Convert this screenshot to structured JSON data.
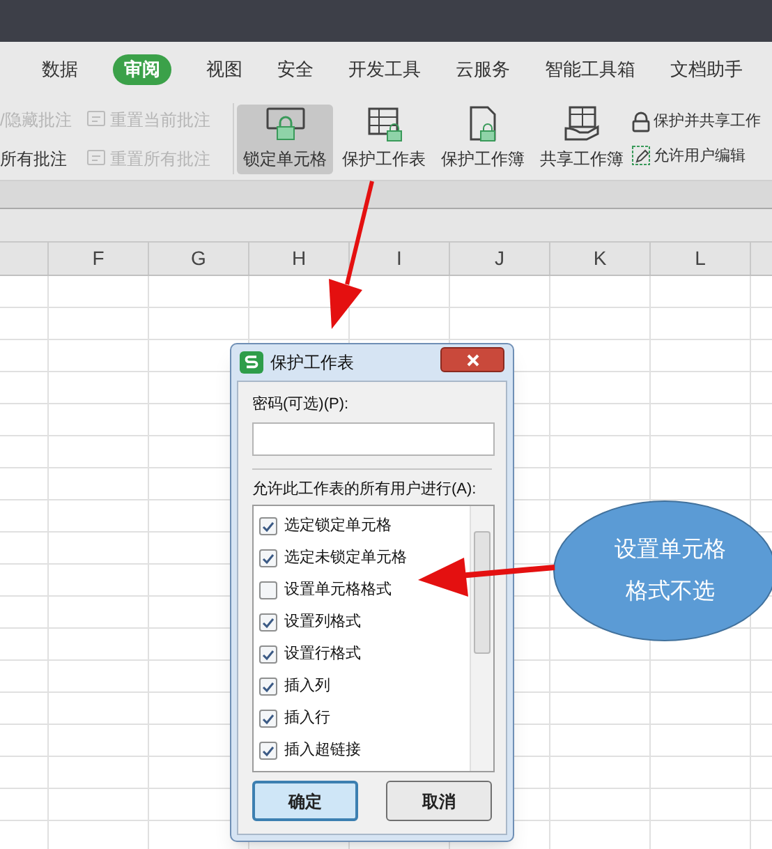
{
  "menu_tabs": [
    {
      "label": "数据",
      "selected": false
    },
    {
      "label": "审阅",
      "selected": true
    },
    {
      "label": "视图",
      "selected": false
    },
    {
      "label": "安全",
      "selected": false
    },
    {
      "label": "开发工具",
      "selected": false
    },
    {
      "label": "云服务",
      "selected": false
    },
    {
      "label": "智能工具箱",
      "selected": false
    },
    {
      "label": "文档助手",
      "selected": false
    }
  ],
  "ribbon": {
    "comment_items": [
      {
        "label": "/隐藏批注",
        "disabled": true,
        "icon": false
      },
      {
        "label": "重置当前批注",
        "disabled": true,
        "icon": true
      },
      {
        "label": "所有批注",
        "disabled": false,
        "icon": false
      },
      {
        "label": "重置所有批注",
        "disabled": true,
        "icon": true
      }
    ],
    "tools": [
      {
        "label": "锁定单元格",
        "selected": true,
        "kind": "lock-cell"
      },
      {
        "label": "保护工作表",
        "selected": false,
        "kind": "sheet"
      },
      {
        "label": "保护工作簿",
        "selected": false,
        "kind": "book"
      },
      {
        "label": "共享工作簿",
        "selected": false,
        "kind": "share"
      }
    ],
    "side_tools": [
      {
        "label": "保护并共享工作",
        "kind": "lock"
      },
      {
        "label": "允许用户编辑",
        "kind": "edit"
      }
    ]
  },
  "column_headers": [
    "F",
    "G",
    "H",
    "I",
    "J",
    "K",
    "L"
  ],
  "dialog": {
    "title": "保护工作表",
    "password_label": "密码(可选)(P):",
    "permissions_label": "允许此工作表的所有用户进行(A):",
    "permissions": [
      {
        "label": "选定锁定单元格",
        "checked": true
      },
      {
        "label": "选定未锁定单元格",
        "checked": true
      },
      {
        "label": "设置单元格格式",
        "checked": false
      },
      {
        "label": "设置列格式",
        "checked": true
      },
      {
        "label": "设置行格式",
        "checked": true
      },
      {
        "label": "插入列",
        "checked": true
      },
      {
        "label": "插入行",
        "checked": true
      },
      {
        "label": "插入超链接",
        "checked": true
      }
    ],
    "buttons": [
      {
        "label": "确定",
        "default": true
      },
      {
        "label": "取消",
        "default": false
      }
    ]
  },
  "callout": {
    "lines": [
      "设置单元格",
      "格式不选"
    ]
  }
}
